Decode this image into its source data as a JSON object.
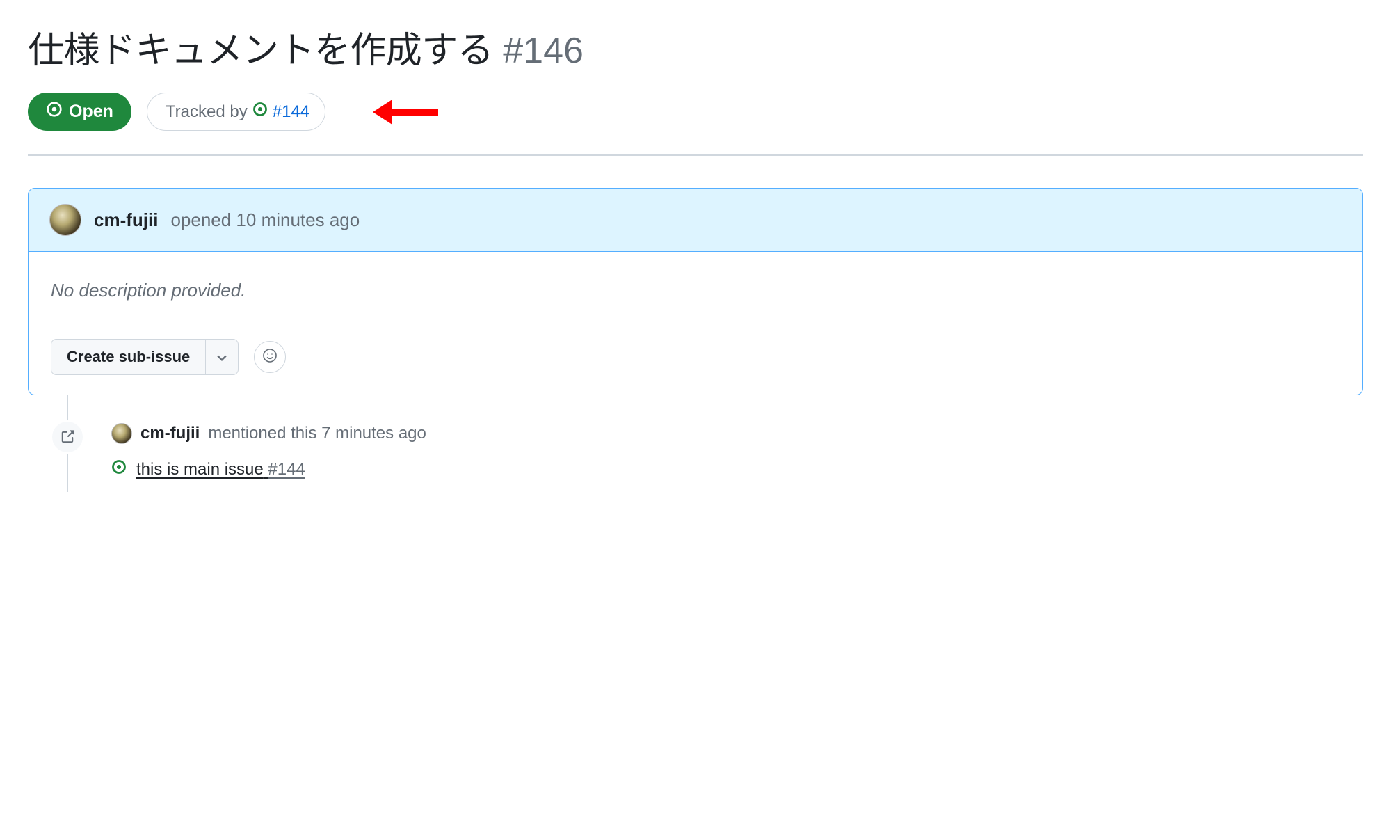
{
  "issue": {
    "title": "仕様ドキュメントを作成する",
    "number": "#146"
  },
  "status": {
    "label": "Open"
  },
  "tracked": {
    "prefix": "Tracked by",
    "ref": "#144"
  },
  "comment": {
    "author": "cm-fujii",
    "meta": "opened 10 minutes ago",
    "no_description": "No description provided.",
    "create_sub_issue": "Create sub-issue"
  },
  "timeline": {
    "author": "cm-fujii",
    "action": "mentioned this 7 minutes ago",
    "ref_title": "this is main issue",
    "ref_number": "#144"
  }
}
